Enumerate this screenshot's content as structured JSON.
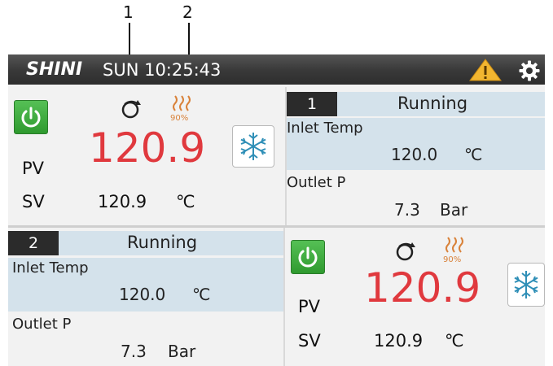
{
  "callouts": [
    "1",
    "2"
  ],
  "topbar": {
    "logo": "SHINI",
    "clock": "SUN 10:25:43",
    "warning_icon": "warning-triangle-icon",
    "settings_icon": "gear-icon"
  },
  "units": [
    {
      "pv_label": "PV",
      "pv_value": "120.9",
      "sv_label": "SV",
      "sv_value": "120.9",
      "sv_unit": "℃",
      "heater_percent": "90%",
      "unit_number": "1",
      "status": "Running",
      "inlet_label": "Inlet Temp",
      "inlet_value": "120.0",
      "inlet_unit": "℃",
      "outlet_label": "Outlet P",
      "outlet_value": "7.3",
      "outlet_unit": "Bar"
    },
    {
      "pv_label": "PV",
      "pv_value": "120.9",
      "sv_label": "SV",
      "sv_value": "120.9",
      "sv_unit": "℃",
      "heater_percent": "90%",
      "unit_number": "2",
      "status": "Running",
      "inlet_label": "Inlet Temp",
      "inlet_value": "120.0",
      "inlet_unit": "℃",
      "outlet_label": "Outlet P",
      "outlet_value": "7.3",
      "outlet_unit": "Bar"
    }
  ],
  "colors": {
    "pv_red": "#e0393e",
    "power_green": "#3fae3f",
    "info_blue": "#d4e2eb",
    "heater_orange": "#d9823a"
  }
}
